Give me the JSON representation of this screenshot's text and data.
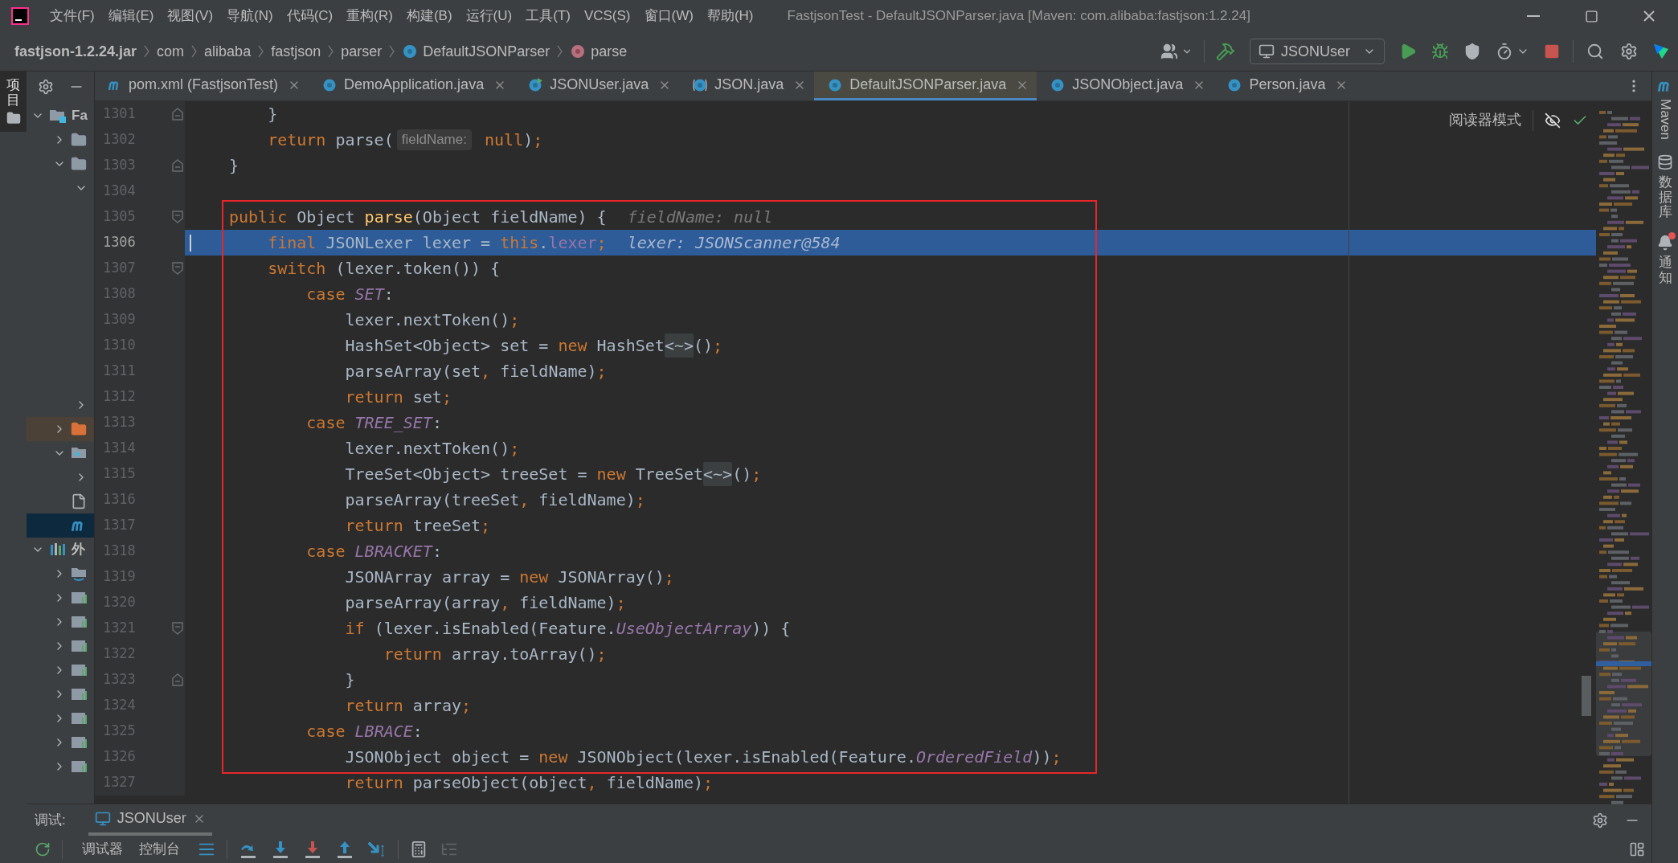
{
  "title_bar": {
    "menu": [
      "文件(F)",
      "编辑(E)",
      "视图(V)",
      "导航(N)",
      "代码(C)",
      "重构(R)",
      "构建(B)",
      "运行(U)",
      "工具(T)",
      "VCS(S)",
      "窗口(W)",
      "帮助(H)"
    ],
    "title": "FastjsonTest - DefaultJSONParser.java [Maven: com.alibaba:fastjson:1.2.24]"
  },
  "navigation_bar": {
    "breadcrumbs": [
      {
        "kind": "jar",
        "label": "fastjson-1.2.24.jar"
      },
      {
        "kind": "package",
        "label": "com"
      },
      {
        "kind": "package",
        "label": "alibaba"
      },
      {
        "kind": "package",
        "label": "fastjson"
      },
      {
        "kind": "package",
        "label": "parser"
      },
      {
        "kind": "class",
        "label": "DefaultJSONParser"
      },
      {
        "kind": "method",
        "label": "parse"
      }
    ],
    "run_configuration": "JSONUser"
  },
  "left_stripe": [
    {
      "label": "项目",
      "selected": true
    }
  ],
  "project_tree": [
    {
      "kind": "module",
      "label": "Fa",
      "expanded": true,
      "selected": false,
      "children": [
        {
          "kind": "folder",
          "expanded": false,
          "selected": false
        },
        {
          "kind": "folder",
          "expanded": true,
          "selected": false,
          "children": [
            {
              "expanded": true,
              "selected": false
            },
            {
              "expanded": false,
              "selected": false
            }
          ]
        },
        {
          "kind": "excluded_folder",
          "expanded": false,
          "selected": false
        },
        {
          "kind": "source_folder",
          "expanded": true,
          "selected": false,
          "children": [
            {
              "expanded": false,
              "selected": false
            }
          ]
        },
        {
          "kind": "file",
          "selected": false
        },
        {
          "kind": "maven",
          "selected": true
        }
      ]
    },
    {
      "kind": "library",
      "label": "外",
      "expanded": true,
      "selected": false,
      "children": [
        {
          "kind": "jdk",
          "expanded": false,
          "selected": false
        },
        {
          "kind": "jar",
          "expanded": false,
          "selected": false
        },
        {
          "kind": "jar",
          "expanded": false,
          "selected": false
        },
        {
          "kind": "jar",
          "expanded": false,
          "selected": false
        },
        {
          "kind": "jar",
          "expanded": false,
          "selected": false
        },
        {
          "kind": "jar",
          "expanded": false,
          "selected": false
        },
        {
          "kind": "jar",
          "expanded": false,
          "selected": false
        },
        {
          "kind": "jar",
          "expanded": false,
          "selected": false
        },
        {
          "kind": "jar",
          "expanded": false,
          "selected": false
        }
      ]
    }
  ],
  "editor_tabs": [
    {
      "kind": "maven",
      "label": "pom.xml (FastjsonTest)",
      "selected": false
    },
    {
      "kind": "class",
      "label": "DemoApplication.java",
      "selected": false
    },
    {
      "kind": "runnable_class",
      "label": "JSONUser.java",
      "selected": false
    },
    {
      "kind": "readonly_class",
      "label": "JSON.java",
      "selected": false
    },
    {
      "kind": "class",
      "label": "DefaultJSONParser.java",
      "selected": true
    },
    {
      "kind": "class",
      "label": "JSONObject.java",
      "selected": false
    },
    {
      "kind": "class",
      "label": "Person.java",
      "selected": false
    }
  ],
  "editor": {
    "reader_mode": "阅读器模式",
    "lines": [
      {
        "number": "1301",
        "current": false,
        "kind": "fold_end",
        "tokens": [
          {
            "kind": "txt",
            "text": "    }"
          }
        ]
      },
      {
        "number": "1302",
        "current": false,
        "kind": "plain",
        "tokens": [
          {
            "kind": "kw",
            "text": "    return "
          },
          {
            "kind": "txt",
            "text": "parse("
          },
          {
            "kind": "hint",
            "text": "fieldName:"
          },
          {
            "kind": "kw",
            "text": " null"
          },
          {
            "kind": "txt",
            "text": ")"
          },
          {
            "kind": "sep",
            "text": ";"
          }
        ]
      },
      {
        "number": "1303",
        "current": false,
        "kind": "fold_end",
        "tokens": [
          {
            "kind": "txt",
            "text": "}"
          }
        ]
      },
      {
        "number": "1304",
        "current": false,
        "kind": "plain"
      },
      {
        "number": "1305",
        "current": false,
        "kind": "fold_start",
        "tokens": [
          {
            "kind": "kw",
            "text": "public "
          },
          {
            "kind": "txt",
            "text": "Object "
          },
          {
            "kind": "method",
            "text": "parse"
          },
          {
            "kind": "txt",
            "text": "(Object fieldName) {"
          },
          {
            "kind": "debug",
            "text": "fieldName: null"
          }
        ]
      },
      {
        "number": "1306",
        "current": true,
        "kind": "plain",
        "tokens": [
          {
            "kind": "kw",
            "text": "    final "
          },
          {
            "kind": "txt",
            "text": "JSONLexer lexer = "
          },
          {
            "kind": "kw",
            "text": "this"
          },
          {
            "kind": "txt",
            "text": "."
          },
          {
            "kind": "field",
            "text": "lexer"
          },
          {
            "kind": "sep",
            "text": ";"
          },
          {
            "kind": "debug",
            "text": "lexer: JSONScanner@584"
          }
        ]
      },
      {
        "number": "1307",
        "current": false,
        "kind": "fold_start",
        "tokens": [
          {
            "kind": "kw",
            "text": "    switch "
          },
          {
            "kind": "txt",
            "text": "(lexer.token()) {"
          }
        ]
      },
      {
        "number": "1308",
        "current": false,
        "kind": "plain",
        "tokens": [
          {
            "kind": "kw",
            "text": "        case "
          },
          {
            "kind": "const",
            "text": "SET"
          },
          {
            "kind": "txt",
            "text": ":"
          }
        ]
      },
      {
        "number": "1309",
        "current": false,
        "kind": "plain",
        "tokens": [
          {
            "kind": "txt",
            "text": "            lexer.nextToken()"
          },
          {
            "kind": "sep",
            "text": ";"
          }
        ]
      },
      {
        "number": "1310",
        "current": false,
        "kind": "plain",
        "tokens": [
          {
            "kind": "txt",
            "text": "            HashSet<Object> set = "
          },
          {
            "kind": "kw",
            "text": "new "
          },
          {
            "kind": "txt",
            "text": "HashSet"
          },
          {
            "kind": "fold",
            "text": "<~>"
          },
          {
            "kind": "txt",
            "text": "()"
          },
          {
            "kind": "sep",
            "text": ";"
          }
        ]
      },
      {
        "number": "1311",
        "current": false,
        "kind": "plain",
        "tokens": [
          {
            "kind": "txt",
            "text": "            parseArray(set"
          },
          {
            "kind": "sep",
            "text": ", "
          },
          {
            "kind": "txt",
            "text": "fieldName)"
          },
          {
            "kind": "sep",
            "text": ";"
          }
        ]
      },
      {
        "number": "1312",
        "current": false,
        "kind": "plain",
        "tokens": [
          {
            "kind": "kw",
            "text": "            return "
          },
          {
            "kind": "txt",
            "text": "set"
          },
          {
            "kind": "sep",
            "text": ";"
          }
        ]
      },
      {
        "number": "1313",
        "current": false,
        "kind": "plain",
        "tokens": [
          {
            "kind": "kw",
            "text": "        case "
          },
          {
            "kind": "const",
            "text": "TREE_SET"
          },
          {
            "kind": "txt",
            "text": ":"
          }
        ]
      },
      {
        "number": "1314",
        "current": false,
        "kind": "plain",
        "tokens": [
          {
            "kind": "txt",
            "text": "            lexer.nextToken()"
          },
          {
            "kind": "sep",
            "text": ";"
          }
        ]
      },
      {
        "number": "1315",
        "current": false,
        "kind": "plain",
        "tokens": [
          {
            "kind": "txt",
            "text": "            TreeSet<Object> treeSet = "
          },
          {
            "kind": "kw",
            "text": "new "
          },
          {
            "kind": "txt",
            "text": "TreeSet"
          },
          {
            "kind": "fold",
            "text": "<~>"
          },
          {
            "kind": "txt",
            "text": "()"
          },
          {
            "kind": "sep",
            "text": ";"
          }
        ]
      },
      {
        "number": "1316",
        "current": false,
        "kind": "plain",
        "tokens": [
          {
            "kind": "txt",
            "text": "            parseArray(treeSet"
          },
          {
            "kind": "sep",
            "text": ", "
          },
          {
            "kind": "txt",
            "text": "fieldName)"
          },
          {
            "kind": "sep",
            "text": ";"
          }
        ]
      },
      {
        "number": "1317",
        "current": false,
        "kind": "plain",
        "tokens": [
          {
            "kind": "kw",
            "text": "            return "
          },
          {
            "kind": "txt",
            "text": "treeSet"
          },
          {
            "kind": "sep",
            "text": ";"
          }
        ]
      },
      {
        "number": "1318",
        "current": false,
        "kind": "plain",
        "tokens": [
          {
            "kind": "kw",
            "text": "        case "
          },
          {
            "kind": "const",
            "text": "LBRACKET"
          },
          {
            "kind": "txt",
            "text": ":"
          }
        ]
      },
      {
        "number": "1319",
        "current": false,
        "kind": "plain",
        "tokens": [
          {
            "kind": "txt",
            "text": "            JSONArray array = "
          },
          {
            "kind": "kw",
            "text": "new "
          },
          {
            "kind": "txt",
            "text": "JSONArray()"
          },
          {
            "kind": "sep",
            "text": ";"
          }
        ]
      },
      {
        "number": "1320",
        "current": false,
        "kind": "plain",
        "tokens": [
          {
            "kind": "txt",
            "text": "            parseArray(array"
          },
          {
            "kind": "sep",
            "text": ", "
          },
          {
            "kind": "txt",
            "text": "fieldName)"
          },
          {
            "kind": "sep",
            "text": ";"
          }
        ]
      },
      {
        "number": "1321",
        "current": false,
        "kind": "fold_start",
        "tokens": [
          {
            "kind": "kw",
            "text": "            if "
          },
          {
            "kind": "txt",
            "text": "(lexer.isEnabled(Feature."
          },
          {
            "kind": "const",
            "text": "UseObjectArray"
          },
          {
            "kind": "txt",
            "text": ")) {"
          }
        ]
      },
      {
        "number": "1322",
        "current": false,
        "kind": "plain",
        "tokens": [
          {
            "kind": "kw",
            "text": "                return "
          },
          {
            "kind": "txt",
            "text": "array.toArray()"
          },
          {
            "kind": "sep",
            "text": ";"
          }
        ]
      },
      {
        "number": "1323",
        "current": false,
        "kind": "fold_end",
        "tokens": [
          {
            "kind": "txt",
            "text": "            }"
          }
        ]
      },
      {
        "number": "1324",
        "current": false,
        "kind": "plain",
        "tokens": [
          {
            "kind": "kw",
            "text": "            return "
          },
          {
            "kind": "txt",
            "text": "array"
          },
          {
            "kind": "sep",
            "text": ";"
          }
        ]
      },
      {
        "number": "1325",
        "current": false,
        "kind": "plain",
        "tokens": [
          {
            "kind": "kw",
            "text": "        case "
          },
          {
            "kind": "const",
            "text": "LBRACE"
          },
          {
            "kind": "txt",
            "text": ":"
          }
        ]
      },
      {
        "number": "1326",
        "current": false,
        "kind": "plain",
        "tokens": [
          {
            "kind": "txt",
            "text": "            JSONObject object = "
          },
          {
            "kind": "kw",
            "text": "new "
          },
          {
            "kind": "txt",
            "text": "JSONObject(lexer.isEnabled(Feature."
          },
          {
            "kind": "const",
            "text": "OrderedField"
          },
          {
            "kind": "txt",
            "text": "))"
          },
          {
            "kind": "sep",
            "text": ";"
          }
        ]
      },
      {
        "number": "1327",
        "current": false,
        "kind": "plain",
        "tokens": [
          {
            "kind": "kw",
            "text": "            return "
          },
          {
            "kind": "txt",
            "text": "parseObject(object"
          },
          {
            "kind": "sep",
            "text": ", "
          },
          {
            "kind": "txt",
            "text": "fieldName)"
          },
          {
            "kind": "sep",
            "text": ";"
          }
        ]
      }
    ]
  },
  "right_stripe": [
    {
      "kind": "maven",
      "label": "Maven",
      "badge": false
    },
    {
      "kind": "database",
      "label": "数据库",
      "badge": false
    },
    {
      "kind": "bell",
      "label": "通知",
      "badge": true
    }
  ],
  "debug_panel": {
    "label": "调试:",
    "sessions": [
      {
        "label": "JSONUser",
        "selected": true
      }
    ],
    "tabs": [
      {
        "label": "调试器",
        "selected": false
      },
      {
        "label": "控制台",
        "selected": false
      }
    ]
  }
}
